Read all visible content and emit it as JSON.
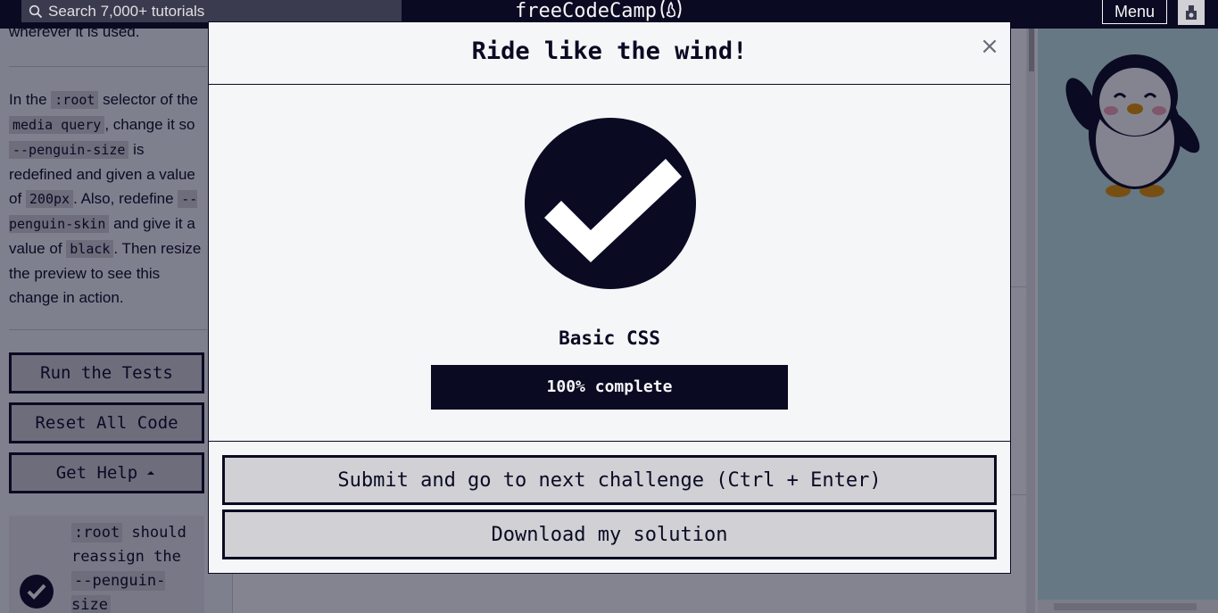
{
  "nav": {
    "search_placeholder": "Search 7,000+ tutorials",
    "brand_text": "freeCodeCamp",
    "menu_label": "Menu"
  },
  "sidebar": {
    "previous_text": "wherever it is used.",
    "instructions": {
      "t1": "In the ",
      "c1": ":root",
      "t2": " selector of the ",
      "c2": "media query",
      "t3": ", change it so ",
      "c3": "--penguin-size",
      "t4": " is redefined and given a value of ",
      "c4": "200px",
      "t5": ". Also, redefine ",
      "c5": "--penguin-skin",
      "t6": " and give it a value of ",
      "c6": "black",
      "t7": ". Then resize the preview to see this change in action."
    },
    "buttons": {
      "run_tests": "Run the Tests",
      "reset_code": "Reset All Code",
      "get_help": "Get Help"
    },
    "test": {
      "code": ":root",
      "text": " should reassign the ",
      "code2": "--penguin-size"
    }
  },
  "modal": {
    "title": "Ride like the wind!",
    "close_label": "×",
    "block_name": "Basic CSS",
    "progress_percent": 100,
    "progress_label": "100% complete",
    "submit_label": "Submit and go to next challenge (Ctrl + Enter)",
    "download_label": "Download my solution"
  },
  "colors": {
    "nav_bg": "#0a0a23",
    "modal_bg": "#f5f6f7",
    "button_bg": "#d0d0d5",
    "preview_bg": "#c2e7e3"
  }
}
